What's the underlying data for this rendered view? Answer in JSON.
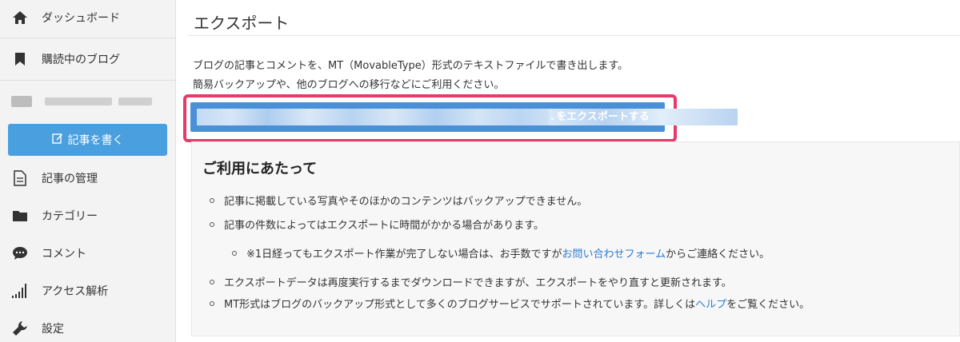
{
  "sidebar": {
    "items": [
      {
        "label": "ダッシュボード",
        "icon": "home-icon"
      },
      {
        "label": "購読中のブログ",
        "icon": "bookmark-icon"
      },
      {
        "label": "記事の管理",
        "icon": "document-icon"
      },
      {
        "label": "カテゴリー",
        "icon": "folder-icon"
      },
      {
        "label": "コメント",
        "icon": "comment-icon"
      },
      {
        "label": "アクセス解析",
        "icon": "bar-chart-icon"
      },
      {
        "label": "設定",
        "icon": "wrench-icon"
      }
    ],
    "write_button": "記事を書く"
  },
  "main": {
    "title": "エクスポート",
    "description_line1": "ブログの記事とコメントを、MT（MovableType）形式のテキストファイルで書き出します。",
    "description_line2": "簡易バックアップや、他のブログへの移行などにご利用ください。",
    "export_button_suffix": "をエクスポートする",
    "notice": {
      "title": "ご利用にあたって",
      "bullet1": "記事に掲載している写真やそのほかのコンテンツはバックアップできません。",
      "bullet2": "記事の件数によってはエクスポートに時間がかかる場合があります。",
      "sub_bullet_pre": "※1日経ってもエクスポート作業が完了しない場合は、お手数ですが ",
      "sub_bullet_link": "お問い合わせフォーム",
      "sub_bullet_post": " からご連絡ください。",
      "bullet3": "エクスポートデータは再度実行するまでダウンロードできますが、エクスポートをやり直すと更新されます。",
      "bullet4_pre": "MT形式はブログのバックアップ形式として多くのブログサービスでサポートされています。詳しくは ",
      "bullet4_link": "ヘルプ",
      "bullet4_post": " をご覧ください。"
    }
  },
  "colors": {
    "accent": "#4a90d9",
    "write_button": "#4a9fdf",
    "highlight": "#e8396b",
    "link": "#2f7bd0"
  }
}
